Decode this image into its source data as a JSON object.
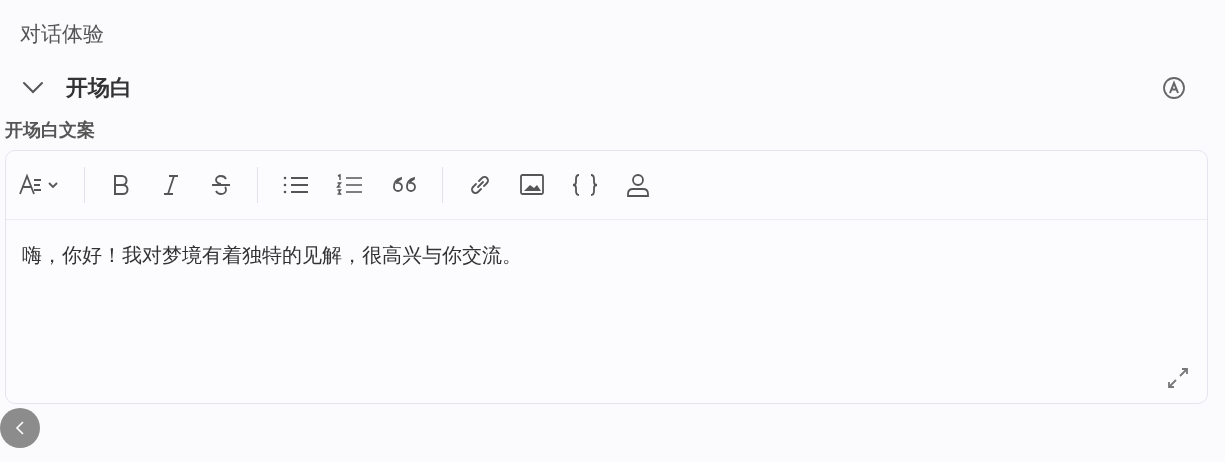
{
  "page": {
    "title": "对话体验"
  },
  "section": {
    "title": "开场白",
    "expanded": true
  },
  "field": {
    "label": "开场白文案",
    "value": "嗨，你好！我对梦境有着独特的见解，很高兴与你交流。"
  },
  "toolbar": [
    [
      {
        "kind": "heading"
      }
    ],
    [
      {
        "kind": "bold"
      },
      {
        "kind": "italic"
      },
      {
        "kind": "strike"
      }
    ],
    [
      {
        "kind": "bullet_list"
      },
      {
        "kind": "ordered_list"
      },
      {
        "kind": "quote"
      }
    ],
    [
      {
        "kind": "link"
      },
      {
        "kind": "image"
      },
      {
        "kind": "code"
      },
      {
        "kind": "mention"
      }
    ]
  ]
}
